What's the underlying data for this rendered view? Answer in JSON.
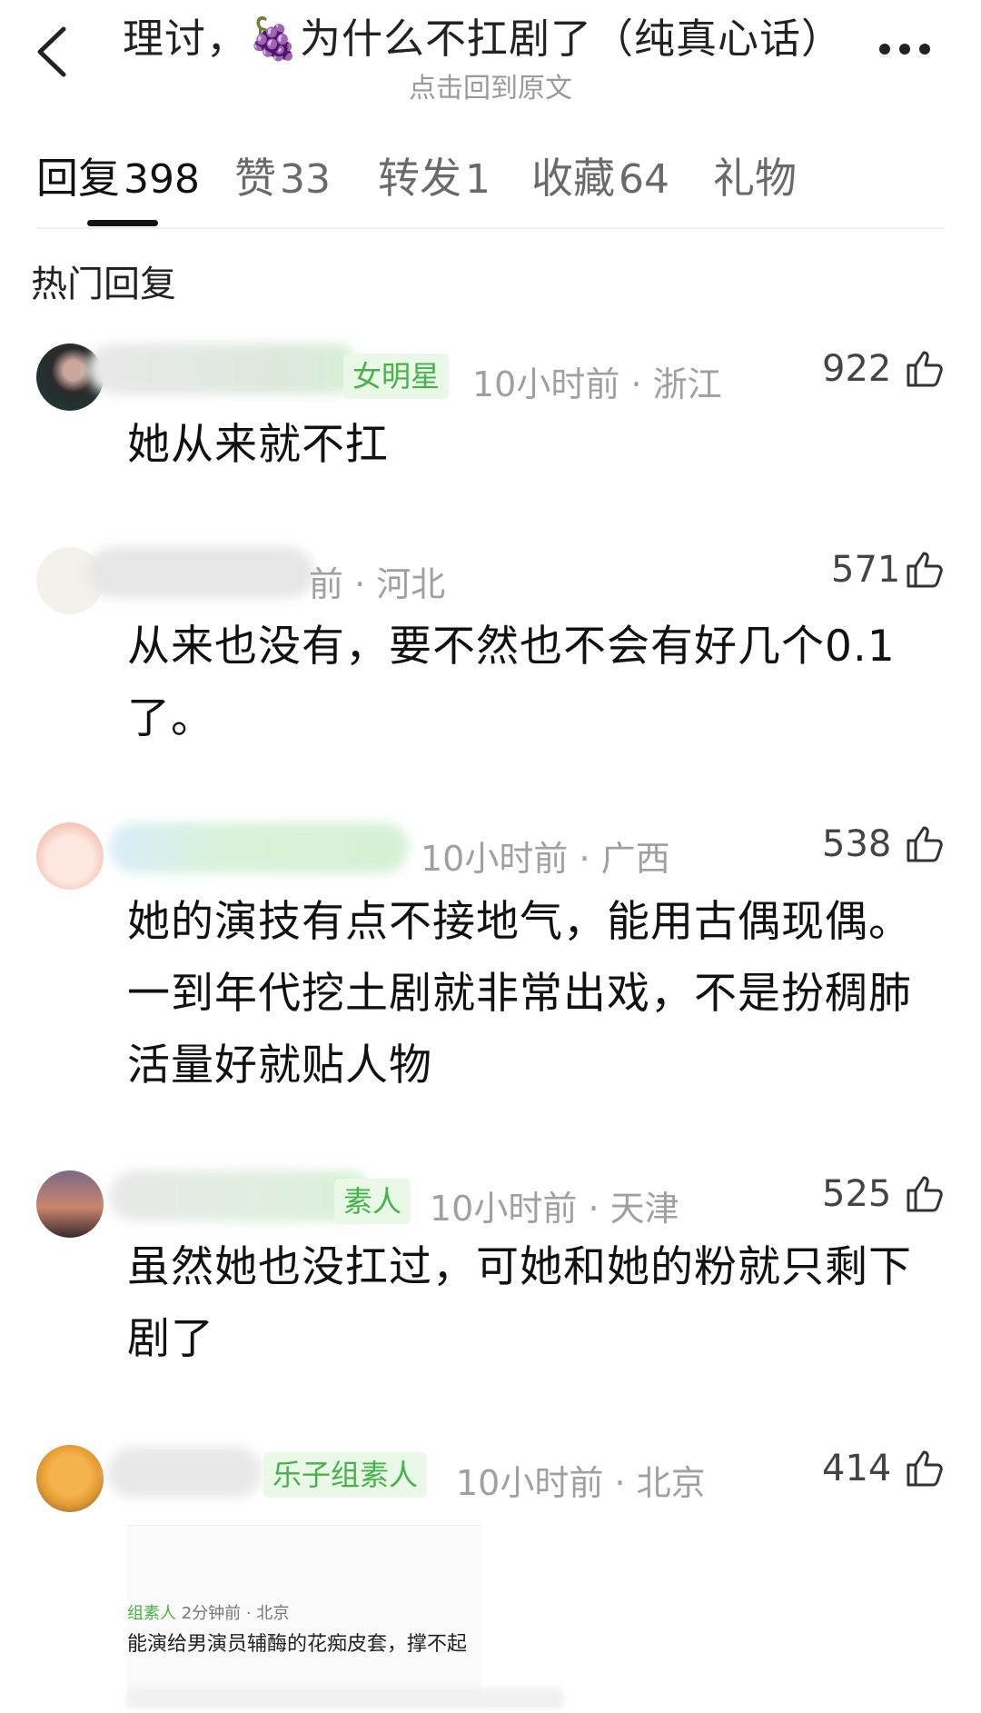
{
  "header": {
    "title": "理讨，🍇为什么不扛剧了（纯真心话）",
    "subtitle": "点击回到原文"
  },
  "tabs": [
    {
      "label": "回复",
      "count": "398"
    },
    {
      "label": "赞",
      "count": "33"
    },
    {
      "label": "转发",
      "count": "1"
    },
    {
      "label": "收藏",
      "count": "64"
    },
    {
      "label": "礼物",
      "count": ""
    }
  ],
  "section_title": "热门回复",
  "comments": [
    {
      "badge": "女明星",
      "time": "10小时前",
      "region": "浙江",
      "likes": "922",
      "text": "她从来就不扛"
    },
    {
      "badge": "",
      "time": "前",
      "region": "河北",
      "likes": "571",
      "text": "从来也没有，要不然也不会有好几个0.1了。"
    },
    {
      "badge": "",
      "time": "10小时前",
      "region": "广西",
      "likes": "538",
      "text": "她的演技有点不接地气，能用古偶现偶。一到年代挖土剧就非常出戏，不是扮稠肺活量好就贴人物"
    },
    {
      "badge": "素人",
      "time": "10小时前",
      "region": "天津",
      "likes": "525",
      "text": "虽然她也没扛过，可她和她的粉就只剩下剧了"
    },
    {
      "badge": "乐子组素人",
      "time": "10小时前",
      "region": "北京",
      "likes": "414",
      "text": ""
    }
  ],
  "quoted": {
    "badge": "组素人",
    "meta": "2分钟前 · 北京",
    "text": "能演给男演员辅酶的花痴皮套，撑不起"
  },
  "colors": {
    "badge_bg": "#e9f8e7",
    "badge_text": "#48b24a",
    "meta_text": "#a0a0a0"
  }
}
